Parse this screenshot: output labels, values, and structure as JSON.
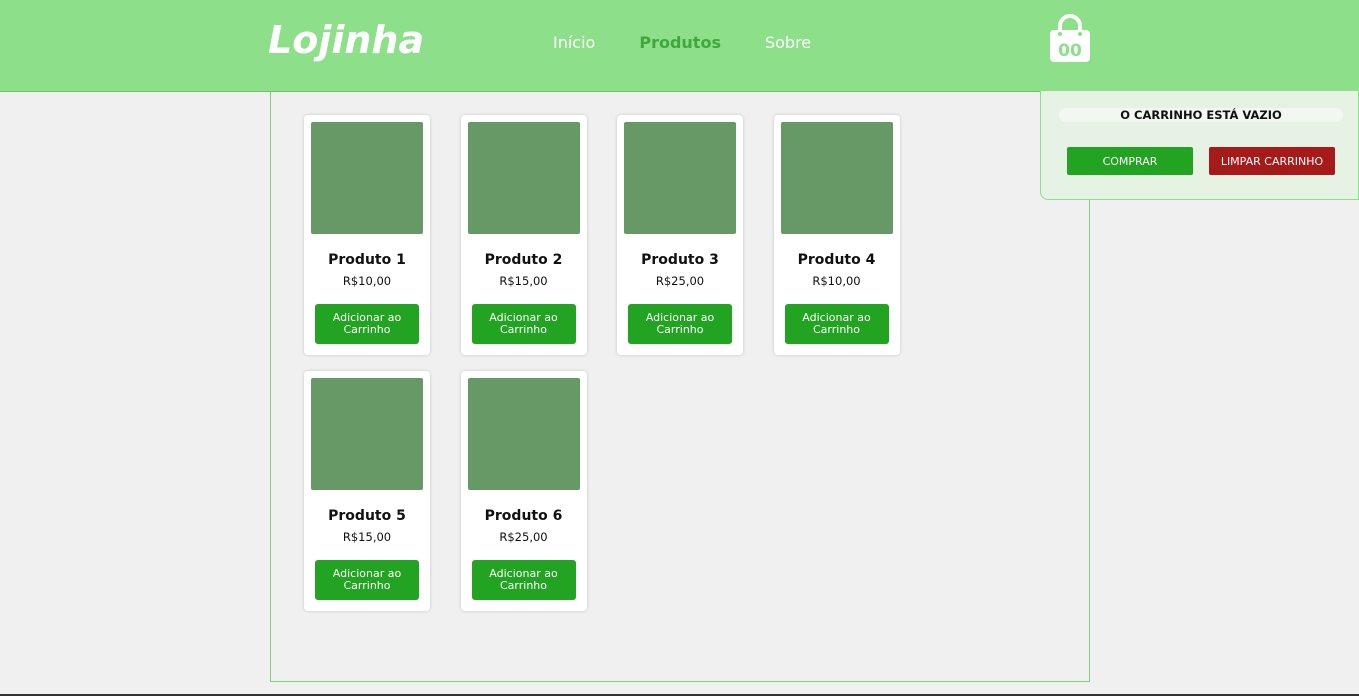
{
  "header": {
    "logo": "Lojinha",
    "nav": [
      {
        "label": "Início",
        "active": false
      },
      {
        "label": "Produtos",
        "active": true
      },
      {
        "label": "Sobre",
        "active": false
      }
    ],
    "cart_icon": "shopping-bag-icon",
    "cart_count": "00"
  },
  "products": [
    {
      "name": "Produto 1",
      "price": "R$10,00",
      "button": "Adicionar ao Carrinho"
    },
    {
      "name": "Produto 2",
      "price": "R$15,00",
      "button": "Adicionar ao Carrinho"
    },
    {
      "name": "Produto 3",
      "price": "R$25,00",
      "button": "Adicionar ao Carrinho"
    },
    {
      "name": "Produto 4",
      "price": "R$10,00",
      "button": "Adicionar ao Carrinho"
    },
    {
      "name": "Produto 5",
      "price": "R$15,00",
      "button": "Adicionar ao Carrinho"
    },
    {
      "name": "Produto 6",
      "price": "R$25,00",
      "button": "Adicionar ao Carrinho"
    }
  ],
  "cart_panel": {
    "message": "O CARRINHO ESTÁ VAZIO",
    "buy_label": "COMPRAR",
    "clear_label": "LIMPAR CARRINHO"
  },
  "colors": {
    "header": "#8ddf8a",
    "nav_active": "#3fa83c",
    "button_green": "#22a322",
    "button_red": "#a61a1a",
    "product_image": "#669966"
  }
}
